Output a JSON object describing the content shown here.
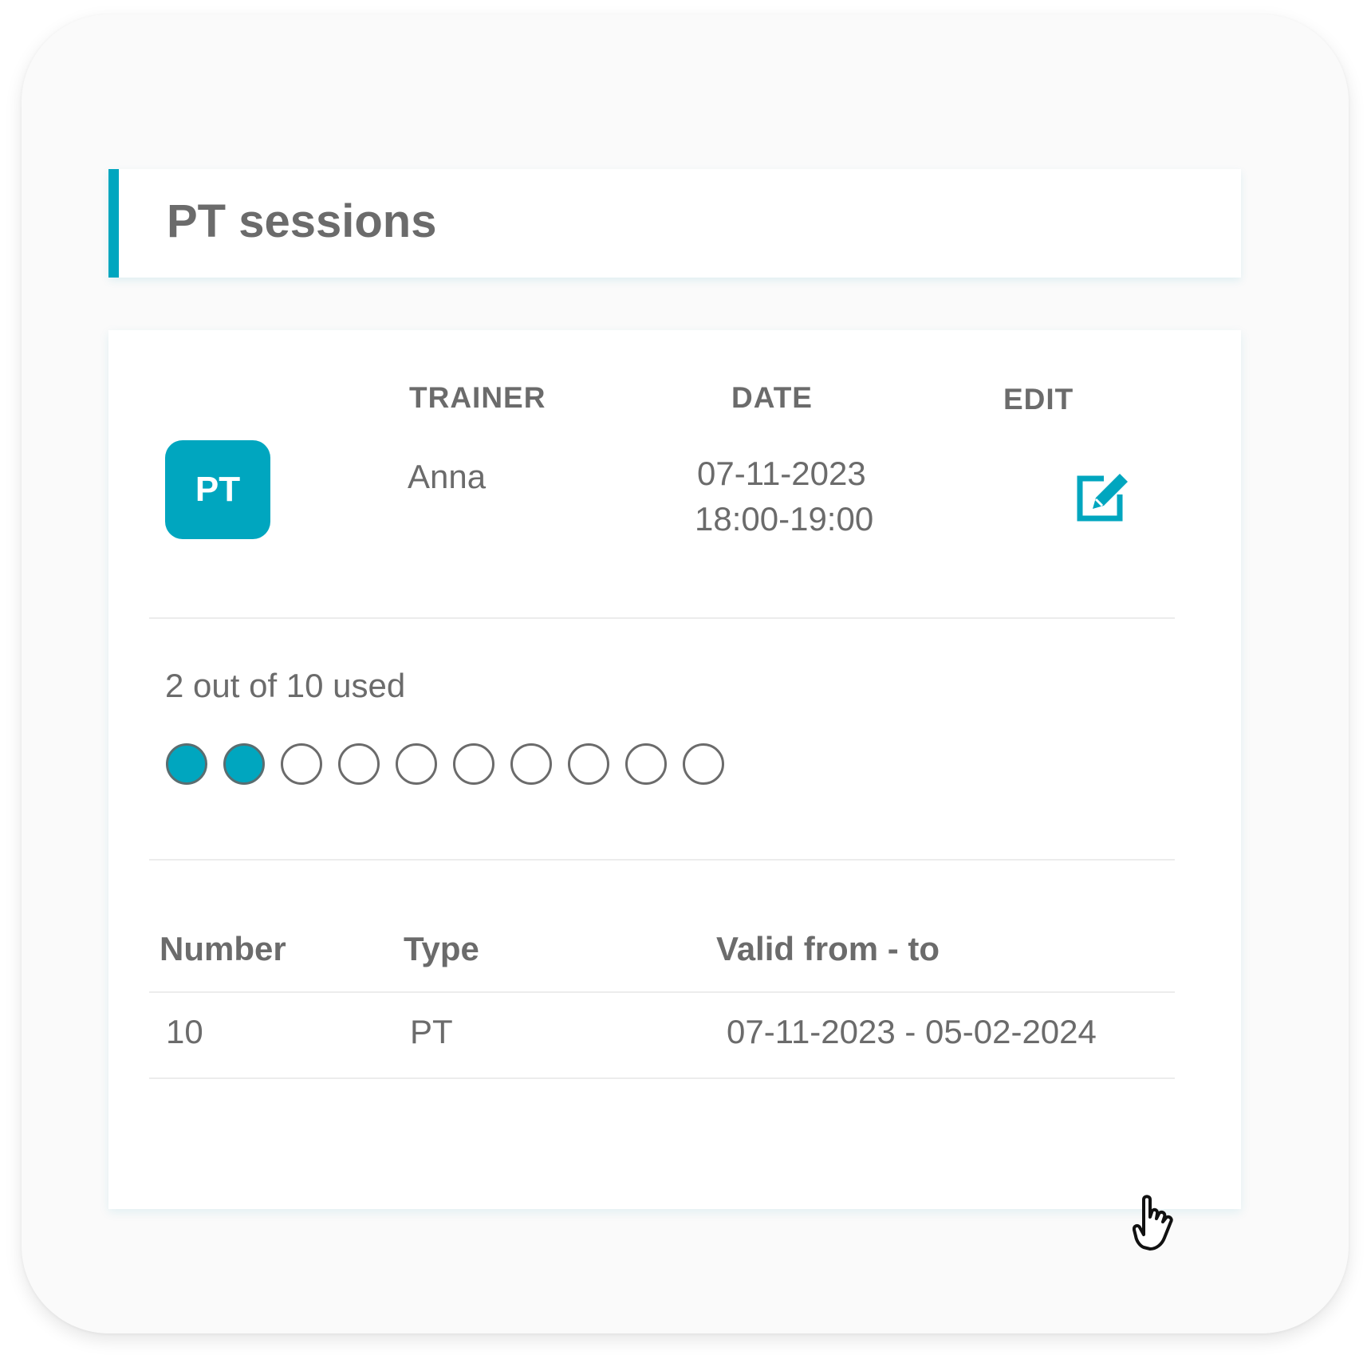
{
  "header": {
    "title": "PT sessions"
  },
  "session": {
    "badge": "PT",
    "trainer_label": "TRAINER",
    "date_label": "DATE",
    "edit_label": "EDIT",
    "trainer": "Anna",
    "date": "07-11-2023",
    "time": "18:00-19:00",
    "edit_icon": "edit-icon"
  },
  "usage": {
    "text": "2 out of 10 used",
    "used": 2,
    "total": 10
  },
  "table": {
    "columns": [
      "Number",
      "Type",
      "Valid from - to"
    ],
    "rows": [
      [
        "10",
        "PT",
        "07-11-2023 - 05-02-2024"
      ]
    ]
  },
  "colors": {
    "accent": "#00a6bf",
    "text": "#6b6b6b"
  }
}
